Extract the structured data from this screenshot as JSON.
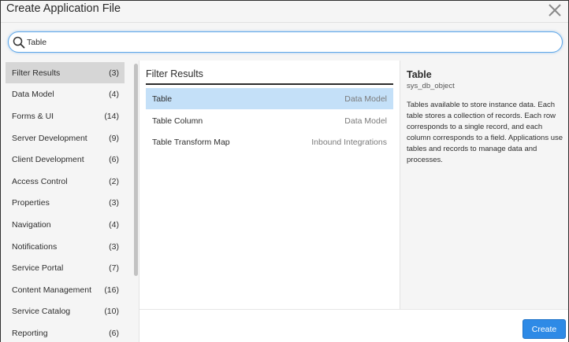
{
  "dialog": {
    "title": "Create Application File"
  },
  "search": {
    "value": "Table",
    "icon": "search-icon"
  },
  "sidebar": {
    "items": [
      {
        "label": "Filter Results",
        "count": "(3)",
        "active": true
      },
      {
        "label": "Data Model",
        "count": "(4)"
      },
      {
        "label": "Forms & UI",
        "count": "(14)"
      },
      {
        "label": "Server Development",
        "count": "(9)"
      },
      {
        "label": "Client Development",
        "count": "(6)"
      },
      {
        "label": "Access Control",
        "count": "(2)"
      },
      {
        "label": "Properties",
        "count": "(3)"
      },
      {
        "label": "Navigation",
        "count": "(4)"
      },
      {
        "label": "Notifications",
        "count": "(3)"
      },
      {
        "label": "Service Portal",
        "count": "(7)"
      },
      {
        "label": "Content Management",
        "count": "(16)"
      },
      {
        "label": "Service Catalog",
        "count": "(10)"
      },
      {
        "label": "Reporting",
        "count": "(6)"
      }
    ]
  },
  "results": {
    "title": "Filter Results",
    "rows": [
      {
        "name": "Table",
        "type": "Data Model",
        "selected": true
      },
      {
        "name": "Table Column",
        "type": "Data Model"
      },
      {
        "name": "Table Transform Map",
        "type": "Inbound Integrations"
      }
    ]
  },
  "details": {
    "title": "Table",
    "subtitle": "sys_db_object",
    "description": "Tables available to store instance data. Each table stores a collection of records. Each row corresponds to a single record, and each column corresponds to a field. Applications use tables and records to manage data and processes."
  },
  "footer": {
    "create_label": "Create"
  },
  "colors": {
    "accent": "#2e8ae6",
    "selected_row": "#c4e0f8",
    "active_sidebar": "#d6d6d6",
    "search_focus": "#5fa7e8"
  }
}
